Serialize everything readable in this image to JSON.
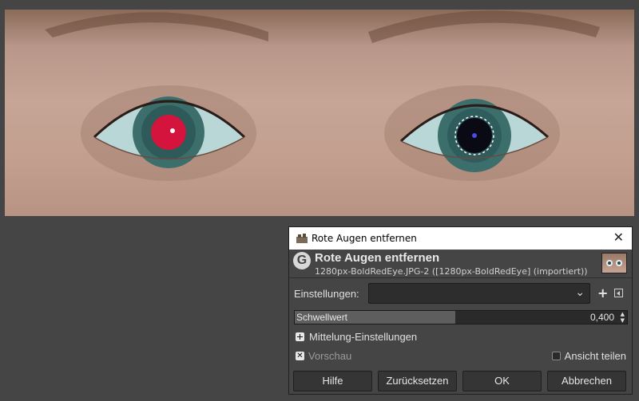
{
  "dialog": {
    "window_title": "Rote Augen entfernen",
    "close_glyph": "✕",
    "filter_title": "Rote Augen entfernen",
    "image_subtitle": "1280px-BoldRedEye.JPG-2 ([1280px-BoldRedEye] (importiert))",
    "logo_letter": "G",
    "presets": {
      "label": "Einstellungen:",
      "value": ""
    },
    "threshold": {
      "label": "Schwellwert",
      "value": "0,400",
      "fraction": 0.484
    },
    "averaging": {
      "label": "Mittelung-Einstellungen"
    },
    "preview": {
      "label": "Vorschau",
      "checked": true
    },
    "split_view": {
      "label": "Ansicht teilen",
      "checked": false
    },
    "buttons": {
      "help": "Hilfe",
      "reset": "Zurücksetzen",
      "ok": "OK",
      "cancel": "Abbrechen"
    }
  },
  "icons": {
    "app": "gimp-wilber-icon",
    "logo": "gimp-logo-icon",
    "close": "close-icon",
    "chevron": "chevron-down-icon",
    "add": "plus-icon",
    "manage": "preset-menu-icon",
    "expand": "plus-box-icon",
    "check": "check-x-icon"
  },
  "colors": {
    "canvas_bg": "#454545",
    "dialog_bg": "#454545",
    "red_eye": "#d4143c",
    "fixed_eye": "#0a0a14"
  }
}
